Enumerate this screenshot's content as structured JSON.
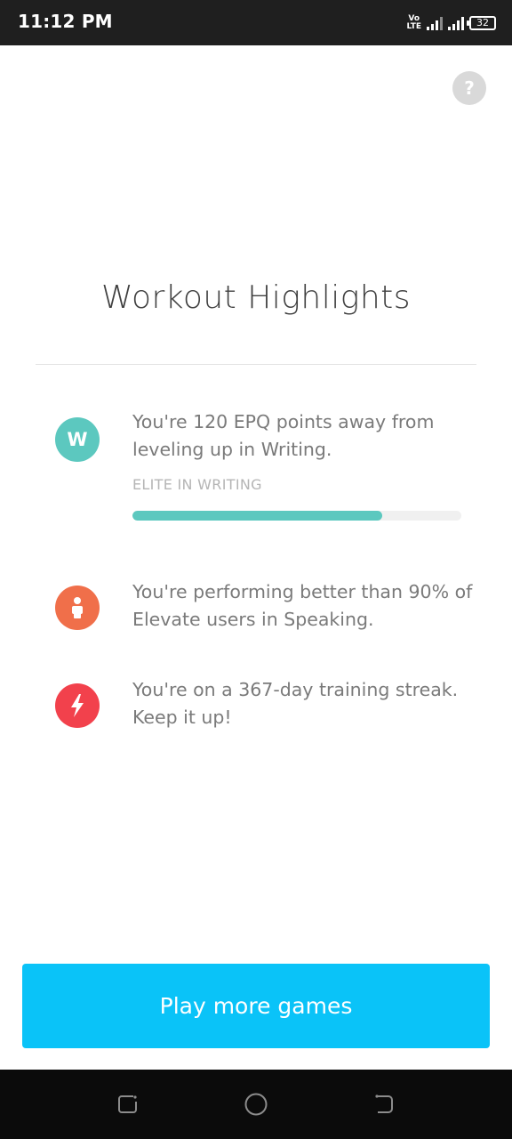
{
  "status_bar": {
    "time": "11:12 PM",
    "volte_top": "Vo",
    "volte_bottom": "LTE",
    "battery": "32"
  },
  "title": "Workout Highlights",
  "highlights": [
    {
      "icon": "writing-icon",
      "icon_letter": "W",
      "color": "#5cc8bf",
      "text": "You're 120 EPQ points away from leveling up in Writing.",
      "level_label": "ELITE IN WRITING",
      "progress": 0.76
    },
    {
      "icon": "person-icon",
      "color": "#f06f4a",
      "text": "You're performing better than 90% of Elevate users in Speaking."
    },
    {
      "icon": "lightning-icon",
      "color": "#f2414c",
      "text": "You're on a 367-day training streak. Keep it up!"
    }
  ],
  "help_icon": "?",
  "play_button_label": "Play more games",
  "colors": {
    "accent": "#0ac3f8",
    "progress_fill": "#5cc8bf"
  }
}
